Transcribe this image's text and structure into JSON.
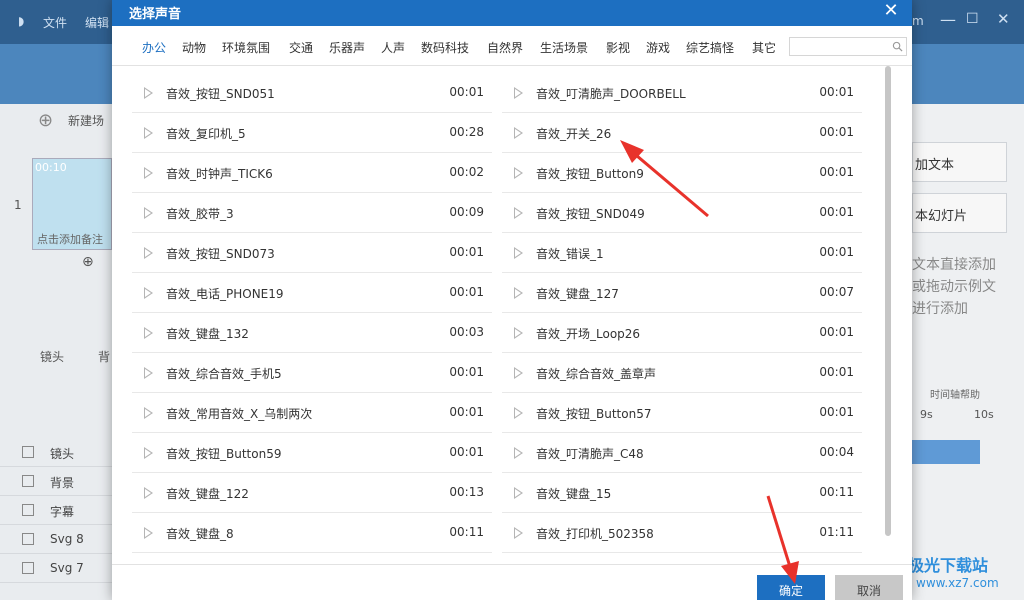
{
  "background_app": {
    "menu": [
      "文件",
      "编辑"
    ],
    "right_menu": "m",
    "new_scene": "新建场",
    "thumb_time": "00:10",
    "thumb_caption": "点击添加备注",
    "thumb_index": "1",
    "tools": [
      "镜头",
      "背"
    ],
    "tracks": [
      "镜头",
      "背景",
      "字幕",
      "Svg 8",
      "Svg 7"
    ],
    "right_buttons": [
      "加文本",
      "本幻灯片"
    ],
    "right_hint": [
      "文本直接添加",
      "或拖动示例文",
      "进行添加"
    ],
    "timeline_help": "时间轴帮助",
    "timeline_ticks": [
      "9s",
      "10s"
    ],
    "watermark": {
      "title": "极光下载站",
      "url": "www.xz7.com"
    }
  },
  "dialog": {
    "title": "选择声音",
    "close_icon": "close-icon",
    "tabs": [
      "办公",
      "动物",
      "环境氛围",
      "交通",
      "乐器声",
      "人声",
      "数码科技",
      "自然界",
      "生活场景",
      "影视",
      "游戏",
      "综艺搞怪",
      "其它"
    ],
    "active_tab": "办公",
    "search": {
      "value": "",
      "placeholder": ""
    },
    "left_column": [
      {
        "name": "音效_按钮_SND051",
        "duration": "00:01"
      },
      {
        "name": "音效_复印机_5",
        "duration": "00:28"
      },
      {
        "name": "音效_时钟声_TICK6",
        "duration": "00:02"
      },
      {
        "name": "音效_胶带_3",
        "duration": "00:09"
      },
      {
        "name": "音效_按钮_SND073",
        "duration": "00:01"
      },
      {
        "name": "音效_电话_PHONE19",
        "duration": "00:01"
      },
      {
        "name": "音效_键盘_132",
        "duration": "00:03"
      },
      {
        "name": "音效_综合音效_手机5",
        "duration": "00:01"
      },
      {
        "name": "音效_常用音效_X_乌制两次",
        "duration": "00:01"
      },
      {
        "name": "音效_按钮_Button59",
        "duration": "00:01"
      },
      {
        "name": "音效_键盘_122",
        "duration": "00:13"
      },
      {
        "name": "音效_键盘_8",
        "duration": "00:11"
      }
    ],
    "right_column": [
      {
        "name": "音效_叮清脆声_DOORBELL",
        "duration": "00:01"
      },
      {
        "name": "音效_开关_26",
        "duration": "00:01"
      },
      {
        "name": "音效_按钮_Button9",
        "duration": "00:01"
      },
      {
        "name": "音效_按钮_SND049",
        "duration": "00:01"
      },
      {
        "name": "音效_错误_1",
        "duration": "00:01"
      },
      {
        "name": "音效_键盘_127",
        "duration": "00:07"
      },
      {
        "name": "音效_开场_Loop26",
        "duration": "00:01"
      },
      {
        "name": "音效_综合音效_盖章声",
        "duration": "00:01"
      },
      {
        "name": "音效_按钮_Button57",
        "duration": "00:01"
      },
      {
        "name": "音效_叮清脆声_C48",
        "duration": "00:04"
      },
      {
        "name": "音效_键盘_15",
        "duration": "00:11"
      },
      {
        "name": "音效_打印机_502358",
        "duration": "01:11"
      }
    ],
    "ok_label": "确定",
    "cancel_label": "取消"
  },
  "colors": {
    "accent": "#1d6fc1",
    "annotation_arrow": "#e8322b"
  }
}
